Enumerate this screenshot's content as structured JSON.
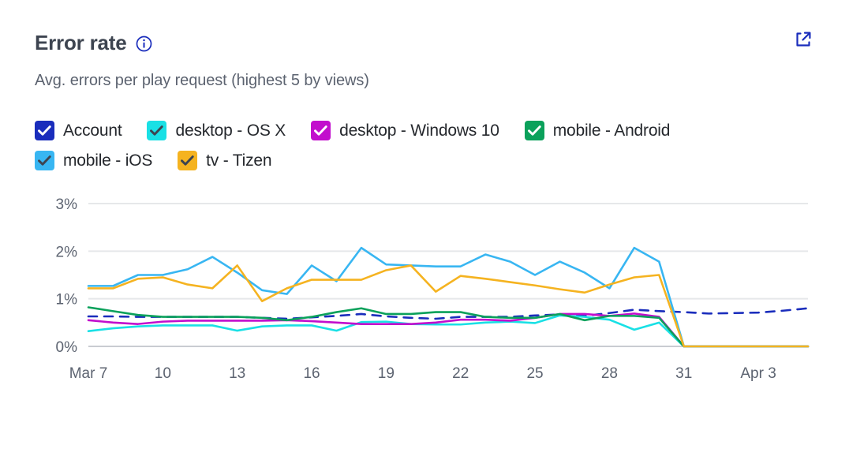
{
  "header": {
    "title": "Error rate",
    "info_icon": "info-circle-icon",
    "share_icon": "share-export-icon",
    "subtitle": "Avg. errors per play request (highest 5 by views)"
  },
  "legend": {
    "items": [
      {
        "label": "Account",
        "color": "#1a2dbc",
        "check_color": "#ffffff",
        "checked": true
      },
      {
        "label": "desktop - OS X",
        "color": "#19e0e5",
        "check_color": "#3d4450",
        "checked": true
      },
      {
        "label": "desktop - Windows 10",
        "color": "#c20ecd",
        "check_color": "#ffffff",
        "checked": true
      },
      {
        "label": "mobile - Android",
        "color": "#0ba15b",
        "check_color": "#ffffff",
        "checked": true
      },
      {
        "label": "mobile - iOS",
        "color": "#38b6f2",
        "check_color": "#3d4450",
        "checked": true
      },
      {
        "label": "tv - Tizen",
        "color": "#f5b320",
        "check_color": "#3d4450",
        "checked": true
      }
    ]
  },
  "chart_data": {
    "type": "line",
    "title": "Error rate",
    "subtitle": "Avg. errors per play request (highest 5 by views)",
    "xlabel": "",
    "ylabel": "",
    "ylim": [
      0,
      3
    ],
    "yticks": [
      0,
      1,
      2,
      3
    ],
    "ytick_labels": [
      "0%",
      "1%",
      "2%",
      "3%"
    ],
    "grid": true,
    "legend_position": "top",
    "x": [
      "Mar 7",
      "Mar 8",
      "Mar 9",
      "Mar 10",
      "Mar 11",
      "Mar 12",
      "Mar 13",
      "Mar 14",
      "Mar 15",
      "Mar 16",
      "Mar 17",
      "Mar 18",
      "Mar 19",
      "Mar 20",
      "Mar 21",
      "Mar 22",
      "Mar 23",
      "Mar 24",
      "Mar 25",
      "Mar 26",
      "Mar 27",
      "Mar 28",
      "Mar 29",
      "Mar 30",
      "Mar 31",
      "Apr 1",
      "Apr 2",
      "Apr 3",
      "Apr 4",
      "Apr 5"
    ],
    "xtick_labels": [
      "Mar 7",
      "10",
      "13",
      "16",
      "19",
      "22",
      "25",
      "28",
      "31",
      "Apr 3"
    ],
    "xtick_indices": [
      0,
      3,
      6,
      9,
      12,
      15,
      18,
      21,
      24,
      27
    ],
    "series": [
      {
        "name": "Account",
        "color": "#1a2dbc",
        "style": "dashed",
        "values": [
          0.63,
          0.63,
          0.62,
          0.62,
          0.62,
          0.62,
          0.62,
          0.6,
          0.58,
          0.61,
          0.64,
          0.68,
          0.63,
          0.6,
          0.58,
          0.62,
          0.62,
          0.62,
          0.65,
          0.67,
          0.64,
          0.7,
          0.77,
          0.74,
          0.72,
          0.69,
          0.7,
          0.71,
          0.75,
          0.8
        ]
      },
      {
        "name": "desktop - OS X",
        "color": "#19e0e5",
        "style": "solid",
        "values": [
          0.32,
          0.38,
          0.42,
          0.44,
          0.44,
          0.44,
          0.33,
          0.42,
          0.44,
          0.44,
          0.33,
          0.51,
          0.52,
          0.47,
          0.46,
          0.46,
          0.5,
          0.52,
          0.49,
          0.65,
          0.62,
          0.56,
          0.35,
          0.5,
          0.0,
          0.0,
          0.0,
          0.0,
          0.0,
          0.0
        ]
      },
      {
        "name": "desktop - Windows 10",
        "color": "#c20ecd",
        "style": "solid",
        "values": [
          0.55,
          0.5,
          0.47,
          0.52,
          0.54,
          0.54,
          0.54,
          0.54,
          0.55,
          0.53,
          0.5,
          0.47,
          0.47,
          0.47,
          0.5,
          0.56,
          0.56,
          0.54,
          0.6,
          0.68,
          0.68,
          0.64,
          0.69,
          0.62,
          0.0,
          0.0,
          0.0,
          0.0,
          0.0,
          0.0
        ]
      },
      {
        "name": "mobile - Android",
        "color": "#0ba15b",
        "style": "solid",
        "values": [
          0.82,
          0.74,
          0.66,
          0.62,
          0.62,
          0.62,
          0.62,
          0.6,
          0.55,
          0.62,
          0.72,
          0.8,
          0.68,
          0.68,
          0.72,
          0.72,
          0.62,
          0.6,
          0.6,
          0.68,
          0.55,
          0.64,
          0.64,
          0.6,
          0.0,
          0.0,
          0.0,
          0.0,
          0.0,
          0.0
        ]
      },
      {
        "name": "mobile - iOS",
        "color": "#38b6f2",
        "style": "solid",
        "values": [
          1.27,
          1.27,
          1.5,
          1.5,
          1.62,
          1.88,
          1.55,
          1.18,
          1.1,
          1.7,
          1.37,
          2.07,
          1.72,
          1.7,
          1.68,
          1.68,
          1.93,
          1.78,
          1.5,
          1.78,
          1.55,
          1.22,
          2.07,
          1.78,
          0.0,
          0.0,
          0.0,
          0.0,
          0.0,
          0.0
        ]
      },
      {
        "name": "tv - Tizen",
        "color": "#f5b320",
        "style": "solid",
        "values": [
          1.22,
          1.22,
          1.42,
          1.45,
          1.3,
          1.22,
          1.7,
          0.95,
          1.22,
          1.4,
          1.4,
          1.4,
          1.6,
          1.7,
          1.15,
          1.48,
          1.42,
          1.35,
          1.28,
          1.2,
          1.13,
          1.3,
          1.45,
          1.5,
          0.0,
          0.0,
          0.0,
          0.0,
          0.0,
          0.0
        ]
      }
    ]
  }
}
